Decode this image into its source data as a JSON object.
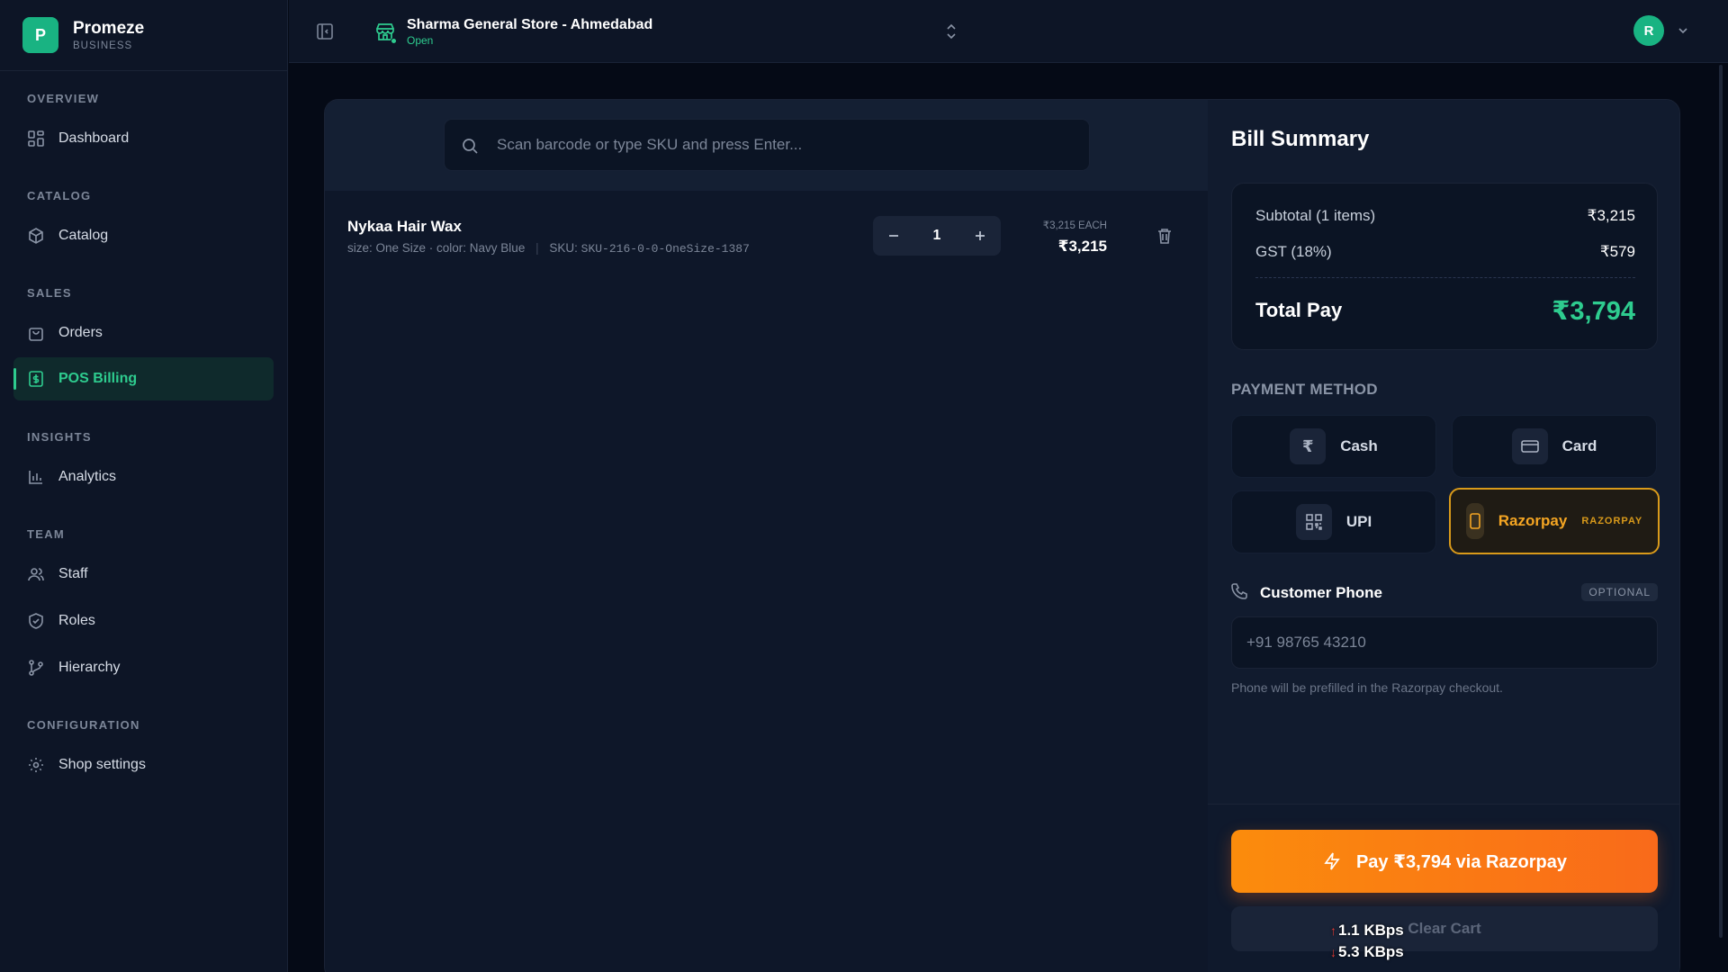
{
  "brand": {
    "name": "Promeze",
    "sub": "BUSINESS",
    "logo": "P"
  },
  "sidebar": {
    "sections": [
      {
        "title": "OVERVIEW",
        "items": [
          {
            "label": "Dashboard",
            "icon": "grid-icon"
          }
        ]
      },
      {
        "title": "CATALOG",
        "items": [
          {
            "label": "Catalog",
            "icon": "box-icon"
          }
        ]
      },
      {
        "title": "SALES",
        "items": [
          {
            "label": "Orders",
            "icon": "bag-icon"
          },
          {
            "label": "POS Billing",
            "icon": "bill-icon",
            "active": true
          }
        ]
      },
      {
        "title": "INSIGHTS",
        "items": [
          {
            "label": "Analytics",
            "icon": "bar-chart-icon"
          }
        ]
      },
      {
        "title": "TEAM",
        "items": [
          {
            "label": "Staff",
            "icon": "users-icon"
          },
          {
            "label": "Roles",
            "icon": "shield-icon"
          },
          {
            "label": "Hierarchy",
            "icon": "branch-icon"
          }
        ]
      },
      {
        "title": "CONFIGURATION",
        "items": [
          {
            "label": "Shop settings",
            "icon": "gear-icon"
          }
        ]
      }
    ]
  },
  "topbar": {
    "store_name": "Sharma General Store - Ahmedabad",
    "store_status": "Open",
    "avatar": "R"
  },
  "search": {
    "placeholder": "Scan barcode or type SKU and press Enter..."
  },
  "cart": {
    "items": [
      {
        "name": "Nykaa Hair Wax",
        "meta": "size: One Size · color: Navy Blue",
        "sku_label": "SKU:",
        "sku": "SKU-216-0-0-OneSize-1387",
        "qty": "1",
        "unit_price": "₹3,215 EACH",
        "line_price": "₹3,215"
      }
    ]
  },
  "summary": {
    "title": "Bill Summary",
    "subtotal_label": "Subtotal (1 items)",
    "subtotal": "₹3,215",
    "gst_label": "GST (18%)",
    "gst": "₹579",
    "total_label": "Total Pay",
    "total": "₹3,794",
    "payment_title": "PAYMENT METHOD",
    "methods": [
      {
        "label": "Cash",
        "icon": "rupee-icon",
        "glyph": "₹"
      },
      {
        "label": "Card",
        "icon": "card-icon"
      },
      {
        "label": "UPI",
        "icon": "qr-icon"
      },
      {
        "label": "Razorpay",
        "icon": "phone-icon",
        "tag": "RAZORPAY",
        "selected": true
      }
    ],
    "phone_label": "Customer Phone",
    "optional": "OPTIONAL",
    "phone_placeholder": "+91 98765 43210",
    "phone_hint": "Phone will be prefilled in the Razorpay checkout.",
    "pay_button": "Pay ₹3,794 via Razorpay",
    "clear_button": "Clear Cart"
  },
  "network": {
    "up": "1.1 KBps",
    "down": "5.3 KBps"
  },
  "colors": {
    "accent": "#2ecc8f",
    "razorpay": "#f5a623",
    "pay_gradient_start": "#fb8c0c",
    "pay_gradient_end": "#f96a1a"
  }
}
